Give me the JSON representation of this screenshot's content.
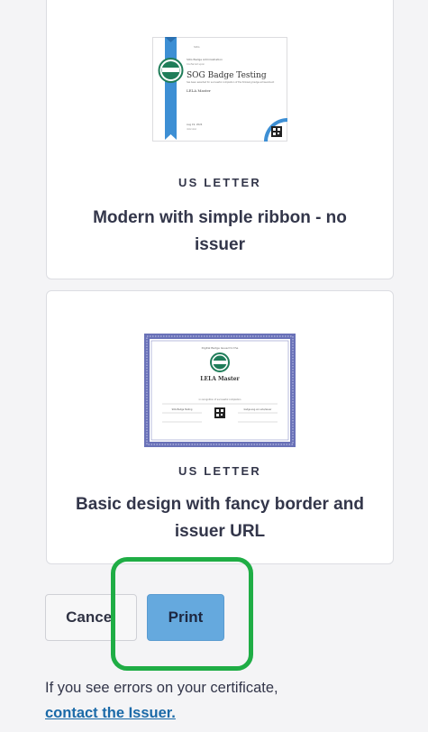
{
  "templates": [
    {
      "paper_size": "US LETTER",
      "title": "Modern with simple ribbon - no issuer",
      "preview": {
        "header": "SOG Badge Administration",
        "subheader": "Conferred upon",
        "cert_title": "SOG Badge Testing",
        "body": "has been awarded for successful completion of the following badge achievement",
        "recipient": "LELA Master",
        "date": "Aug 19, 2024",
        "footer": "date label"
      }
    },
    {
      "paper_size": "US LETTER",
      "title": "Basic design with fancy border and issuer URL",
      "preview": {
        "header": "Digital Badge Issued to the",
        "cert_title": "LELA Master",
        "body": "in recognition of successful completion",
        "left_name": "SOG Badge Testing",
        "right_name": "badge.sog.unc.edu/issuer"
      }
    }
  ],
  "actions": {
    "cancel_label": "Cancel",
    "print_label": "Print"
  },
  "footer": {
    "text": "If you see errors on your certificate,",
    "link_label": "contact the Issuer."
  },
  "colors": {
    "background": "#f4f4f6",
    "primary_button": "#65a9de",
    "link": "#1b6aa8",
    "highlight": "#1fad45",
    "ribbon": "#3d8fd4",
    "seal": "#1f7d59",
    "fancy_border": "#6a72b8"
  }
}
